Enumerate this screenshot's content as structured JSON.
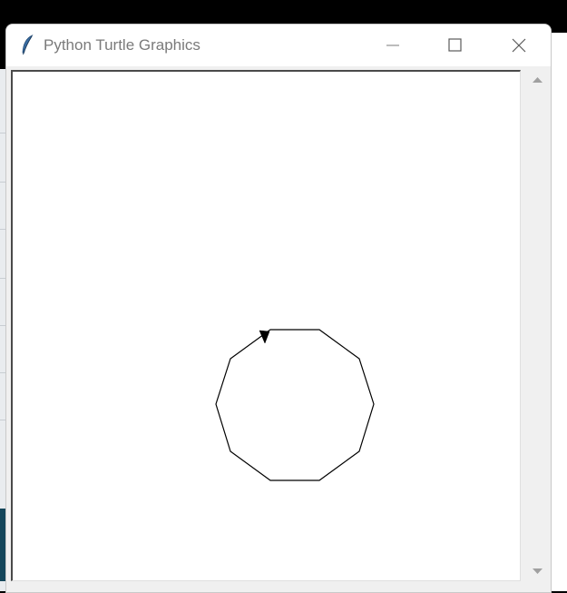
{
  "window": {
    "title": "Python Turtle Graphics",
    "app_icon": "feather-icon"
  },
  "title_controls": {
    "minimize_icon": "minimize-icon",
    "maximize_icon": "maximize-icon",
    "close_icon": "close-icon"
  },
  "canvas": {
    "background": "#ffffff",
    "drawing": {
      "shape": "decagon",
      "sides": 10,
      "line_color": "#000000",
      "turtle_icon": "turtle-arrow-icon"
    }
  },
  "scrollbar": {
    "up_icon": "scroll-up-icon",
    "down_icon": "scroll-down-icon"
  },
  "colors": {
    "titlebar": "#ffffff",
    "title_text": "#7a7a7a",
    "frame": "#f0f0f0",
    "scroll_arrow": "#a0a0a0"
  }
}
